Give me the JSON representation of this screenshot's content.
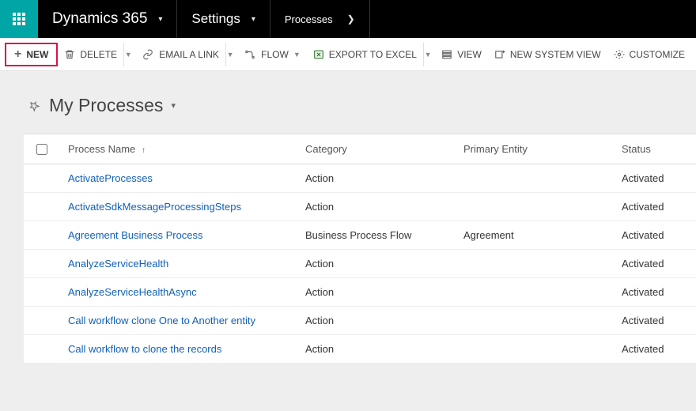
{
  "topnav": {
    "brand": "Dynamics 365",
    "settings": "Settings",
    "crumb": "Processes"
  },
  "cmdbar": {
    "new": "NEW",
    "delete": "DELETE",
    "email": "EMAIL A LINK",
    "flow": "FLOW",
    "export": "EXPORT TO EXCEL",
    "view": "VIEW",
    "newSystemView": "NEW SYSTEM VIEW",
    "customize": "CUSTOMIZE"
  },
  "viewTitle": "My Processes",
  "columns": {
    "name": "Process Name",
    "category": "Category",
    "entity": "Primary Entity",
    "status": "Status"
  },
  "rows": [
    {
      "name": "ActivateProcesses",
      "category": "Action",
      "entity": "",
      "status": "Activated"
    },
    {
      "name": "ActivateSdkMessageProcessingSteps",
      "category": "Action",
      "entity": "",
      "status": "Activated"
    },
    {
      "name": "Agreement Business Process",
      "category": "Business Process Flow",
      "entity": "Agreement",
      "status": "Activated"
    },
    {
      "name": "AnalyzeServiceHealth",
      "category": "Action",
      "entity": "",
      "status": "Activated"
    },
    {
      "name": "AnalyzeServiceHealthAsync",
      "category": "Action",
      "entity": "",
      "status": "Activated"
    },
    {
      "name": "Call workflow clone One to Another entity",
      "category": "Action",
      "entity": "",
      "status": "Activated"
    },
    {
      "name": "Call workflow to clone the records",
      "category": "Action",
      "entity": "",
      "status": "Activated"
    }
  ]
}
